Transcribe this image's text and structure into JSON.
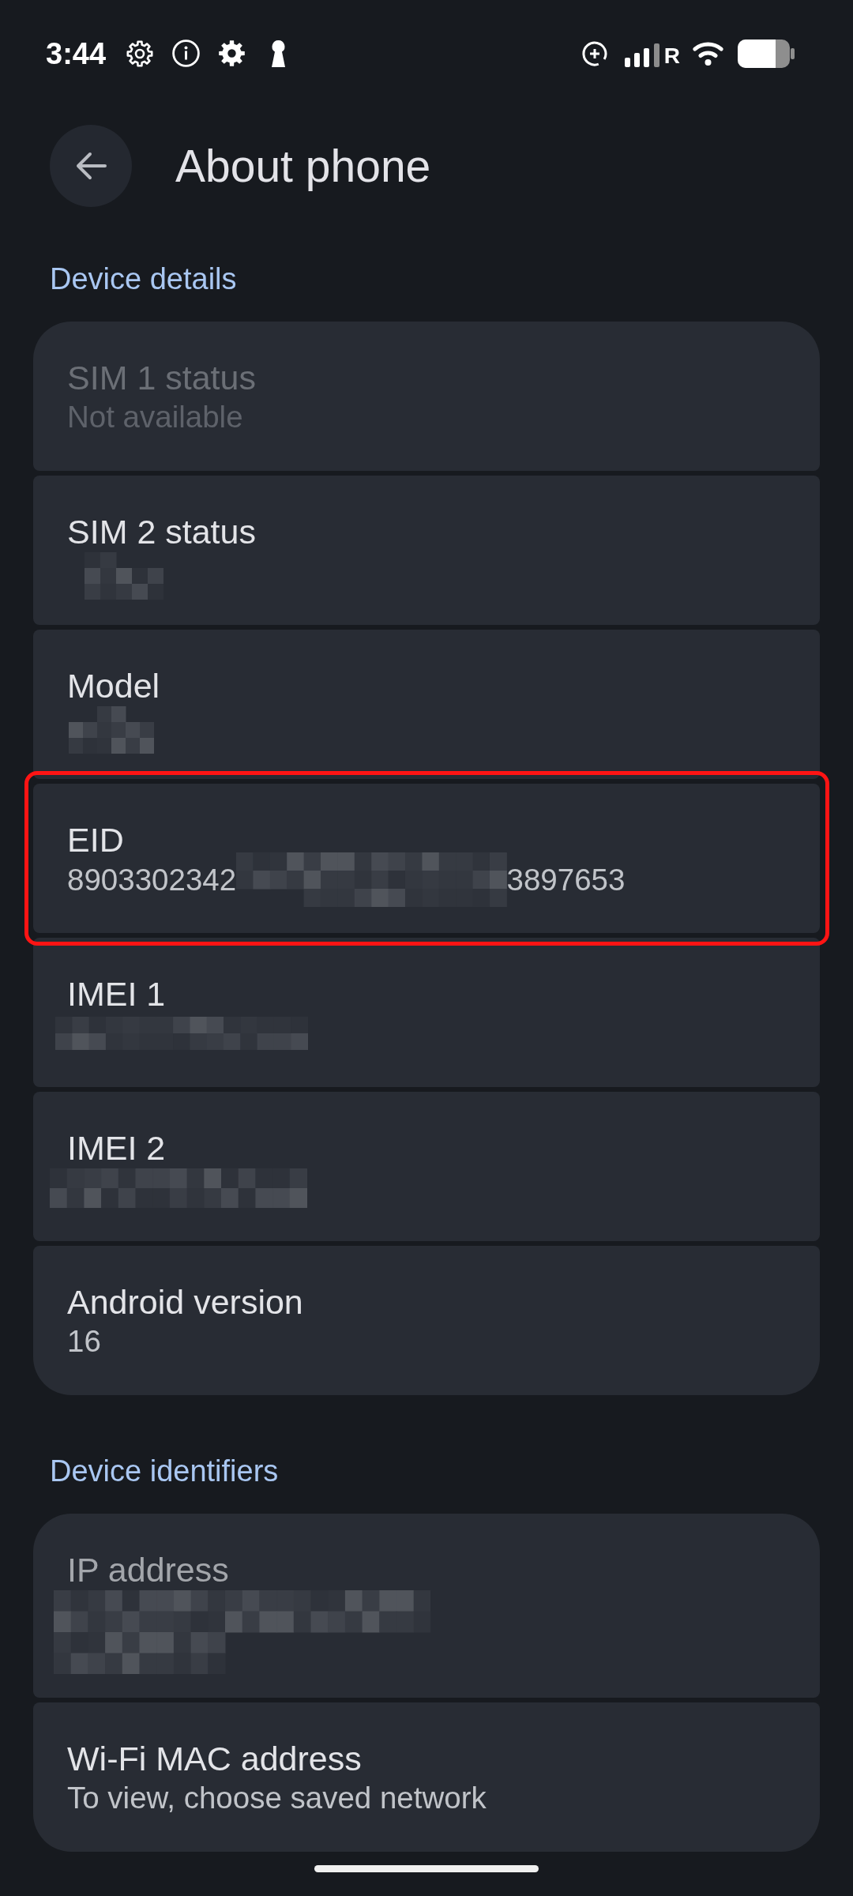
{
  "status_bar": {
    "time": "3:44",
    "roaming": "R"
  },
  "header": {
    "title": "About phone"
  },
  "sections": [
    {
      "heading": "Device details",
      "items": [
        {
          "title": "SIM 1 status",
          "value": [
            {
              "kind": "text",
              "text": "Not available"
            }
          ],
          "disabled": true,
          "dimmed": false,
          "highlighted": false
        },
        {
          "title": "SIM 2 status",
          "value": [
            {
              "kind": "redaction"
            }
          ],
          "disabled": false,
          "dimmed": false,
          "highlighted": false
        },
        {
          "title": "Model",
          "value": [
            {
              "kind": "redaction"
            }
          ],
          "disabled": false,
          "dimmed": false,
          "highlighted": false
        },
        {
          "title": "EID",
          "value": [
            {
              "kind": "text",
              "text": "8903302342"
            },
            {
              "kind": "redaction"
            },
            {
              "kind": "text",
              "text": "3897653"
            }
          ],
          "disabled": false,
          "dimmed": false,
          "highlighted": true
        },
        {
          "title": "IMEI 1",
          "value": [
            {
              "kind": "redaction"
            }
          ],
          "disabled": false,
          "dimmed": false,
          "highlighted": false
        },
        {
          "title": "IMEI 2",
          "value": [
            {
              "kind": "redaction"
            }
          ],
          "disabled": false,
          "dimmed": false,
          "highlighted": false
        },
        {
          "title": "Android version",
          "value": [
            {
              "kind": "text",
              "text": "16"
            }
          ],
          "disabled": false,
          "dimmed": false,
          "highlighted": false
        }
      ]
    },
    {
      "heading": "Device identifiers",
      "items": [
        {
          "title": "IP address",
          "value": [
            {
              "kind": "redaction"
            }
          ],
          "disabled": false,
          "dimmed": true,
          "highlighted": false
        },
        {
          "title": "Wi-Fi MAC address",
          "value": [
            {
              "kind": "text",
              "text": "To view, choose saved network"
            }
          ],
          "disabled": false,
          "dimmed": false,
          "highlighted": false
        }
      ]
    }
  ]
}
